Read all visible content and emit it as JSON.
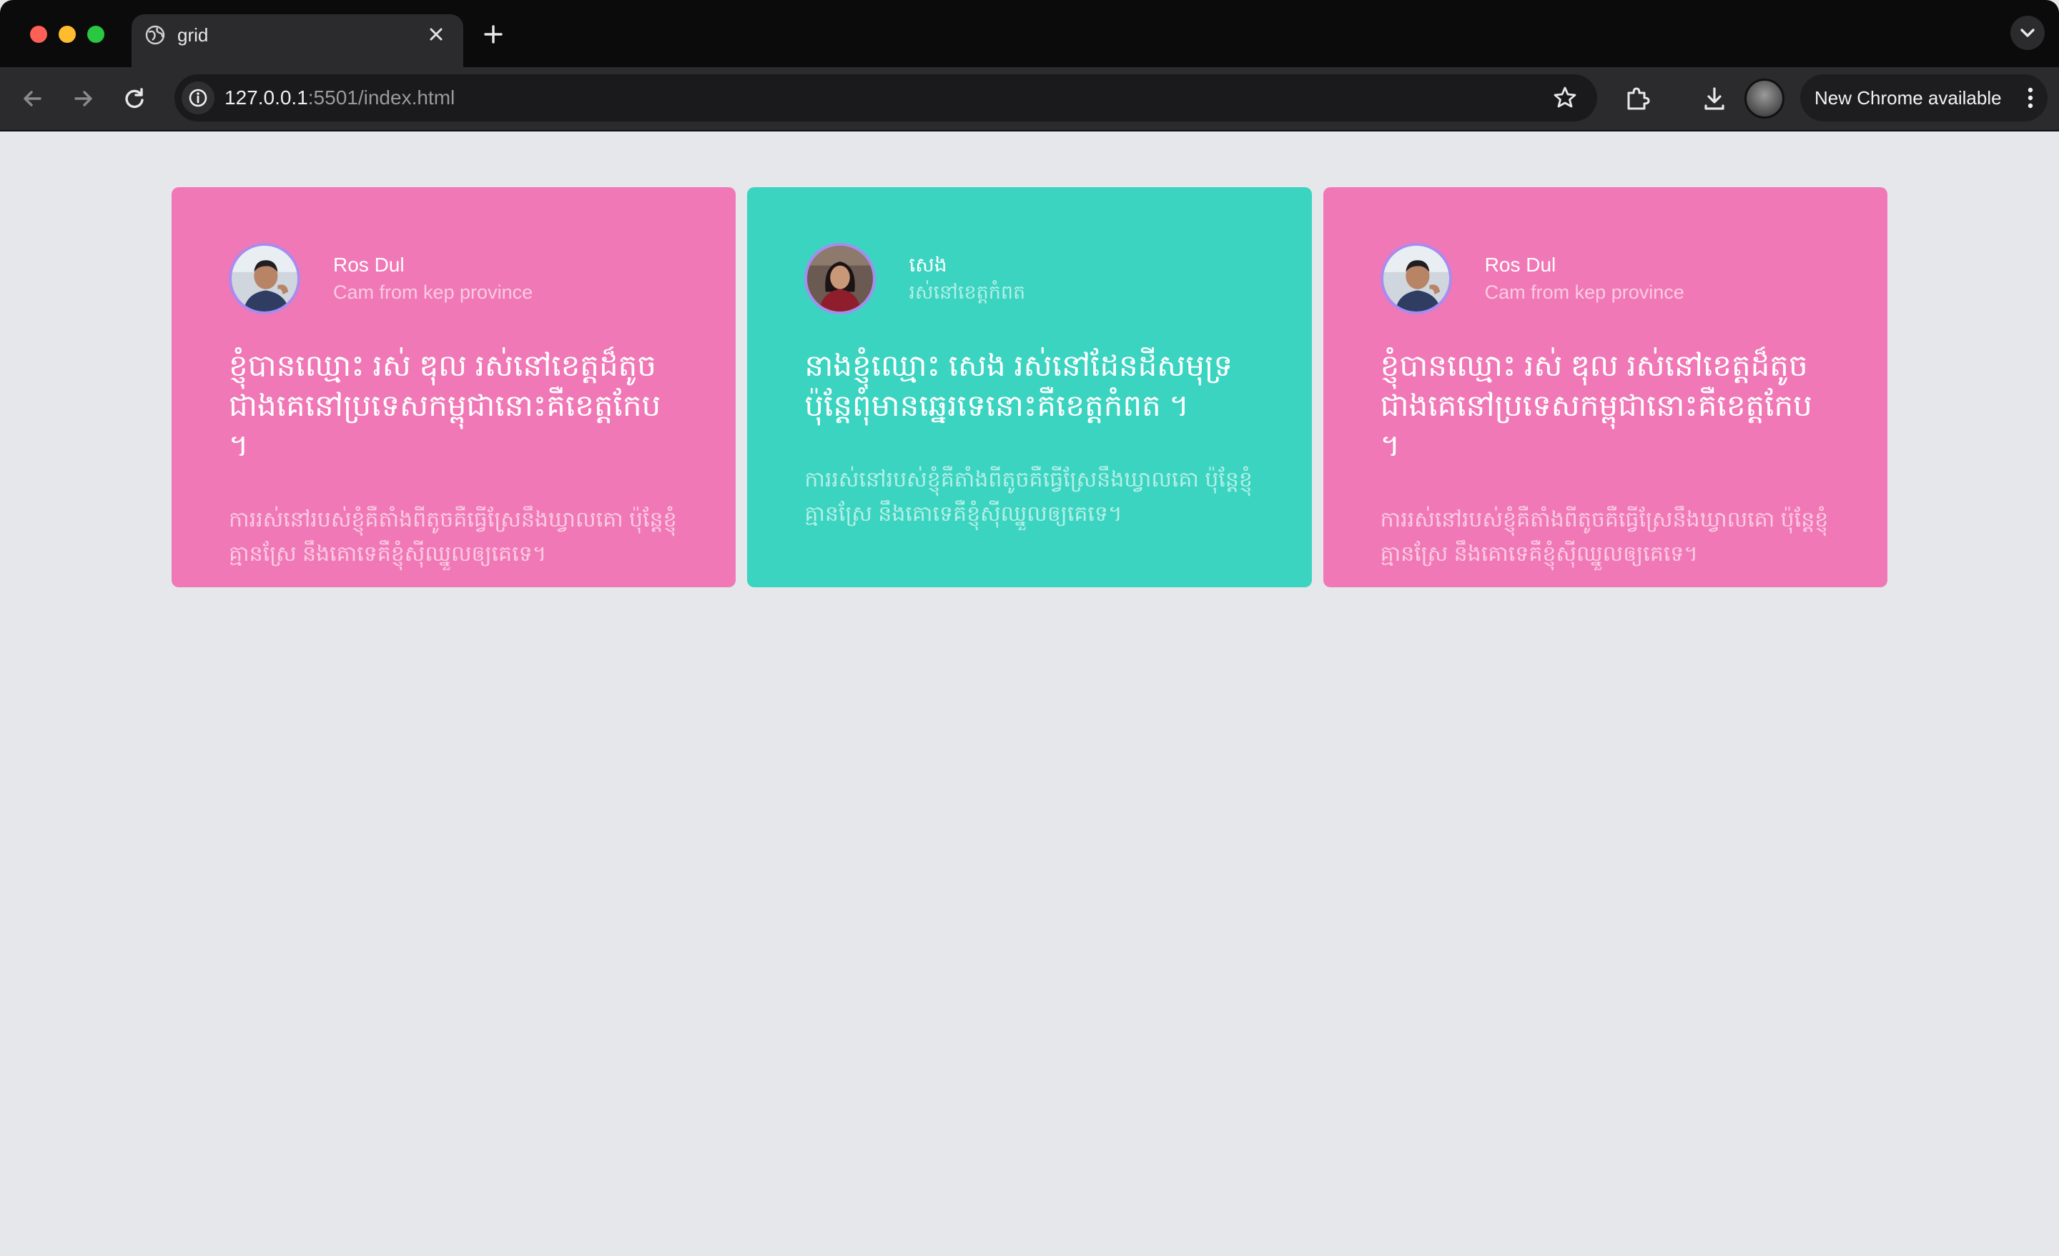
{
  "browser": {
    "tab_title": "grid",
    "url_host": "127.0.0.1",
    "url_rest": ":5501/index.html",
    "update_label": "New Chrome available"
  },
  "icons": {
    "tab_favicon": "globe-icon",
    "tab_close": "close-icon",
    "new_tab": "plus-icon",
    "tab_search": "chevron-down-icon",
    "back": "arrow-left-icon",
    "forward": "arrow-right-icon",
    "reload": "reload-icon",
    "site_info": "info-icon",
    "bookmark": "star-icon",
    "extensions": "puzzle-icon",
    "downloads": "download-icon",
    "menu": "kebab-menu-icon"
  },
  "colors": {
    "pink_card": "#f178b6",
    "teal_card": "#3bd4c0",
    "page_bg": "#e5e7eb",
    "avatar_ring": "#a98bf0"
  },
  "cards": [
    {
      "color": "pink",
      "name": "Ros Dul",
      "subtitle": "Cam from kep province",
      "title": "ខ្ញុំបានឈ្មោះ រស់ ឌុល រស់នៅខេត្តដ៏តូចជាងគេនៅប្រទេសកម្ពុជានោះគឺខេត្តកែប ។",
      "body": "ការរស់នៅរបស់ខ្ញុំគឺតាំងពីតូចគឺធ្វើស្រែនឹងឃ្វាលគោ ប៉ុន្តែខ្ញុំគ្មានស្រែ នឹងគោទេគឺខ្ញុំស៊ីឈ្នួលឲ្យគេទេ។"
    },
    {
      "color": "teal",
      "name": "សេង",
      "subtitle": "រស់នៅខេត្តកំពត",
      "title": "នាងខ្ញុំឈ្មោះ សេង រស់នៅដែនដីសមុទ្រ ប៉ុន្តែពុំមានឆ្នេរទេនោះគឺខេត្តកំពត ។",
      "body": "ការរស់នៅរបស់ខ្ញុំគឺតាំងពីតូចគឺធ្វើស្រែនឹងឃ្វាលគោ ប៉ុន្តែខ្ញុំគ្មានស្រែ នឹងគោទេគឺខ្ញុំស៊ីឈ្នួលឲ្យគេទេ។"
    },
    {
      "color": "pink",
      "name": "Ros Dul",
      "subtitle": "Cam from kep province",
      "title": "ខ្ញុំបានឈ្មោះ រស់ ឌុល រស់នៅខេត្តដ៏តូចជាងគេនៅប្រទេសកម្ពុជានោះគឺខេត្តកែប ។",
      "body": "ការរស់នៅរបស់ខ្ញុំគឺតាំងពីតូចគឺធ្វើស្រែនឹងឃ្វាលគោ ប៉ុន្តែខ្ញុំគ្មានស្រែ នឹងគោទេគឺខ្ញុំស៊ីឈ្នួលឲ្យគេទេ។"
    }
  ]
}
